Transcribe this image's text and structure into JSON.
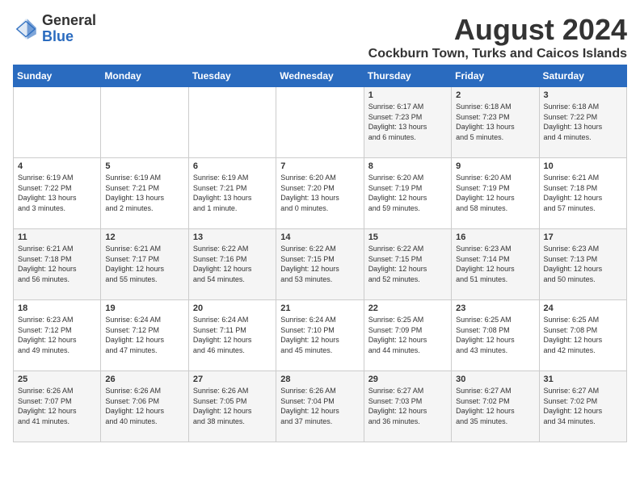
{
  "header": {
    "logo_general": "General",
    "logo_blue": "Blue",
    "month_title": "August 2024",
    "location": "Cockburn Town, Turks and Caicos Islands"
  },
  "days_of_week": [
    "Sunday",
    "Monday",
    "Tuesday",
    "Wednesday",
    "Thursday",
    "Friday",
    "Saturday"
  ],
  "weeks": [
    [
      {
        "day": "",
        "info": ""
      },
      {
        "day": "",
        "info": ""
      },
      {
        "day": "",
        "info": ""
      },
      {
        "day": "",
        "info": ""
      },
      {
        "day": "1",
        "info": "Sunrise: 6:17 AM\nSunset: 7:23 PM\nDaylight: 13 hours\nand 6 minutes."
      },
      {
        "day": "2",
        "info": "Sunrise: 6:18 AM\nSunset: 7:23 PM\nDaylight: 13 hours\nand 5 minutes."
      },
      {
        "day": "3",
        "info": "Sunrise: 6:18 AM\nSunset: 7:22 PM\nDaylight: 13 hours\nand 4 minutes."
      }
    ],
    [
      {
        "day": "4",
        "info": "Sunrise: 6:19 AM\nSunset: 7:22 PM\nDaylight: 13 hours\nand 3 minutes."
      },
      {
        "day": "5",
        "info": "Sunrise: 6:19 AM\nSunset: 7:21 PM\nDaylight: 13 hours\nand 2 minutes."
      },
      {
        "day": "6",
        "info": "Sunrise: 6:19 AM\nSunset: 7:21 PM\nDaylight: 13 hours\nand 1 minute."
      },
      {
        "day": "7",
        "info": "Sunrise: 6:20 AM\nSunset: 7:20 PM\nDaylight: 13 hours\nand 0 minutes."
      },
      {
        "day": "8",
        "info": "Sunrise: 6:20 AM\nSunset: 7:19 PM\nDaylight: 12 hours\nand 59 minutes."
      },
      {
        "day": "9",
        "info": "Sunrise: 6:20 AM\nSunset: 7:19 PM\nDaylight: 12 hours\nand 58 minutes."
      },
      {
        "day": "10",
        "info": "Sunrise: 6:21 AM\nSunset: 7:18 PM\nDaylight: 12 hours\nand 57 minutes."
      }
    ],
    [
      {
        "day": "11",
        "info": "Sunrise: 6:21 AM\nSunset: 7:18 PM\nDaylight: 12 hours\nand 56 minutes."
      },
      {
        "day": "12",
        "info": "Sunrise: 6:21 AM\nSunset: 7:17 PM\nDaylight: 12 hours\nand 55 minutes."
      },
      {
        "day": "13",
        "info": "Sunrise: 6:22 AM\nSunset: 7:16 PM\nDaylight: 12 hours\nand 54 minutes."
      },
      {
        "day": "14",
        "info": "Sunrise: 6:22 AM\nSunset: 7:15 PM\nDaylight: 12 hours\nand 53 minutes."
      },
      {
        "day": "15",
        "info": "Sunrise: 6:22 AM\nSunset: 7:15 PM\nDaylight: 12 hours\nand 52 minutes."
      },
      {
        "day": "16",
        "info": "Sunrise: 6:23 AM\nSunset: 7:14 PM\nDaylight: 12 hours\nand 51 minutes."
      },
      {
        "day": "17",
        "info": "Sunrise: 6:23 AM\nSunset: 7:13 PM\nDaylight: 12 hours\nand 50 minutes."
      }
    ],
    [
      {
        "day": "18",
        "info": "Sunrise: 6:23 AM\nSunset: 7:12 PM\nDaylight: 12 hours\nand 49 minutes."
      },
      {
        "day": "19",
        "info": "Sunrise: 6:24 AM\nSunset: 7:12 PM\nDaylight: 12 hours\nand 47 minutes."
      },
      {
        "day": "20",
        "info": "Sunrise: 6:24 AM\nSunset: 7:11 PM\nDaylight: 12 hours\nand 46 minutes."
      },
      {
        "day": "21",
        "info": "Sunrise: 6:24 AM\nSunset: 7:10 PM\nDaylight: 12 hours\nand 45 minutes."
      },
      {
        "day": "22",
        "info": "Sunrise: 6:25 AM\nSunset: 7:09 PM\nDaylight: 12 hours\nand 44 minutes."
      },
      {
        "day": "23",
        "info": "Sunrise: 6:25 AM\nSunset: 7:08 PM\nDaylight: 12 hours\nand 43 minutes."
      },
      {
        "day": "24",
        "info": "Sunrise: 6:25 AM\nSunset: 7:08 PM\nDaylight: 12 hours\nand 42 minutes."
      }
    ],
    [
      {
        "day": "25",
        "info": "Sunrise: 6:26 AM\nSunset: 7:07 PM\nDaylight: 12 hours\nand 41 minutes."
      },
      {
        "day": "26",
        "info": "Sunrise: 6:26 AM\nSunset: 7:06 PM\nDaylight: 12 hours\nand 40 minutes."
      },
      {
        "day": "27",
        "info": "Sunrise: 6:26 AM\nSunset: 7:05 PM\nDaylight: 12 hours\nand 38 minutes."
      },
      {
        "day": "28",
        "info": "Sunrise: 6:26 AM\nSunset: 7:04 PM\nDaylight: 12 hours\nand 37 minutes."
      },
      {
        "day": "29",
        "info": "Sunrise: 6:27 AM\nSunset: 7:03 PM\nDaylight: 12 hours\nand 36 minutes."
      },
      {
        "day": "30",
        "info": "Sunrise: 6:27 AM\nSunset: 7:02 PM\nDaylight: 12 hours\nand 35 minutes."
      },
      {
        "day": "31",
        "info": "Sunrise: 6:27 AM\nSunset: 7:02 PM\nDaylight: 12 hours\nand 34 minutes."
      }
    ]
  ]
}
